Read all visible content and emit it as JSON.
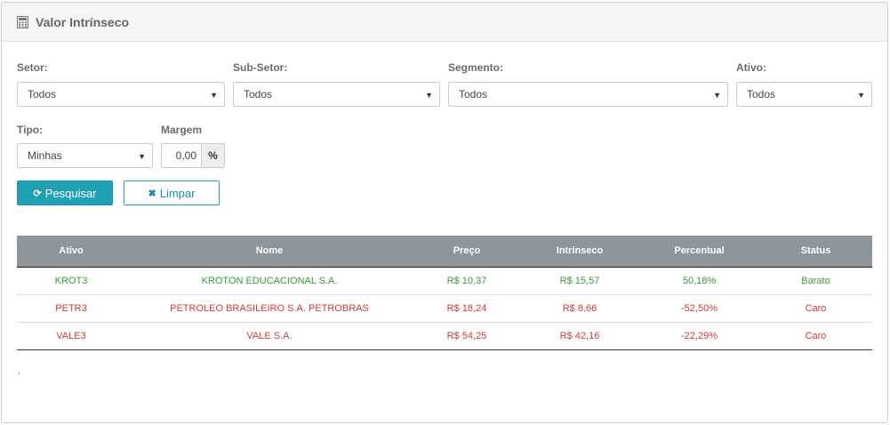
{
  "header": {
    "title": "Valor Intrínseco"
  },
  "filters": {
    "setor": {
      "label": "Setor:",
      "value": "Todos"
    },
    "subsetor": {
      "label": "Sub-Setor:",
      "value": "Todos"
    },
    "segmento": {
      "label": "Segmento:",
      "value": "Todos"
    },
    "ativo": {
      "label": "Ativo:",
      "value": "Todos"
    },
    "tipo": {
      "label": "Tipo:",
      "value": "Minhas"
    },
    "margem": {
      "label": "Margem",
      "value": "0,00",
      "addon": "%"
    }
  },
  "buttons": {
    "search_label": "Pesquisar",
    "clear_label": "Limpar"
  },
  "colors": {
    "accent": "#1fa0b3",
    "header_gray": "#8e959b",
    "positive": "#3a9a3a",
    "negative": "#cf3b3b"
  },
  "table": {
    "columns": [
      "Ativo",
      "Nome",
      "Preço",
      "Intrínseco",
      "Percentual",
      "Status"
    ],
    "rows": [
      {
        "ativo": "KROT3",
        "nome": "KROTON EDUCACIONAL S.A.",
        "preco": "R$ 10,37",
        "intrinseco": "R$ 15,57",
        "percentual": "50,18%",
        "status": "Barato",
        "tone": "green"
      },
      {
        "ativo": "PETR3",
        "nome": "PETROLEO BRASILEIRO S.A. PETROBRAS",
        "preco": "R$ 18,24",
        "intrinseco": "R$ 8,66",
        "percentual": "-52,50%",
        "status": "Caro",
        "tone": "red"
      },
      {
        "ativo": "VALE3",
        "nome": "VALE S.A.",
        "preco": "R$ 54,25",
        "intrinseco": "R$ 42,16",
        "percentual": "-22,29%",
        "status": "Caro",
        "tone": "red"
      }
    ]
  },
  "footer": {
    "mark": ","
  }
}
